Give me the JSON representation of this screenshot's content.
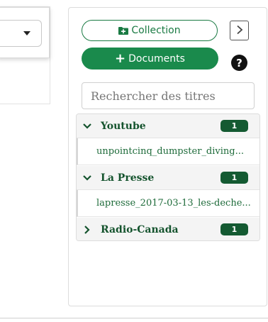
{
  "left": {
    "select_value": ""
  },
  "toolbar": {
    "collection_label": "Collection",
    "documents_label": "Documents",
    "help_label": "?"
  },
  "search": {
    "placeholder": "Rechercher des titres"
  },
  "groups": [
    {
      "name": "Youtube",
      "count": "1",
      "expanded": true,
      "items": [
        "unpointcinq_dumpster_diving..."
      ]
    },
    {
      "name": "La Presse",
      "count": "1",
      "expanded": true,
      "items": [
        "lapresse_2017-03-13_les-deche..."
      ]
    },
    {
      "name": "Radio-Canada",
      "count": "1",
      "expanded": false,
      "items": []
    }
  ],
  "colors": {
    "accent": "#1a8a4c",
    "badge": "#145a32",
    "text_green": "#14532d"
  },
  "icons": {
    "collection": "folder-plus-icon",
    "expand_panel": "chevron-right-icon",
    "help": "question-circle-icon"
  }
}
